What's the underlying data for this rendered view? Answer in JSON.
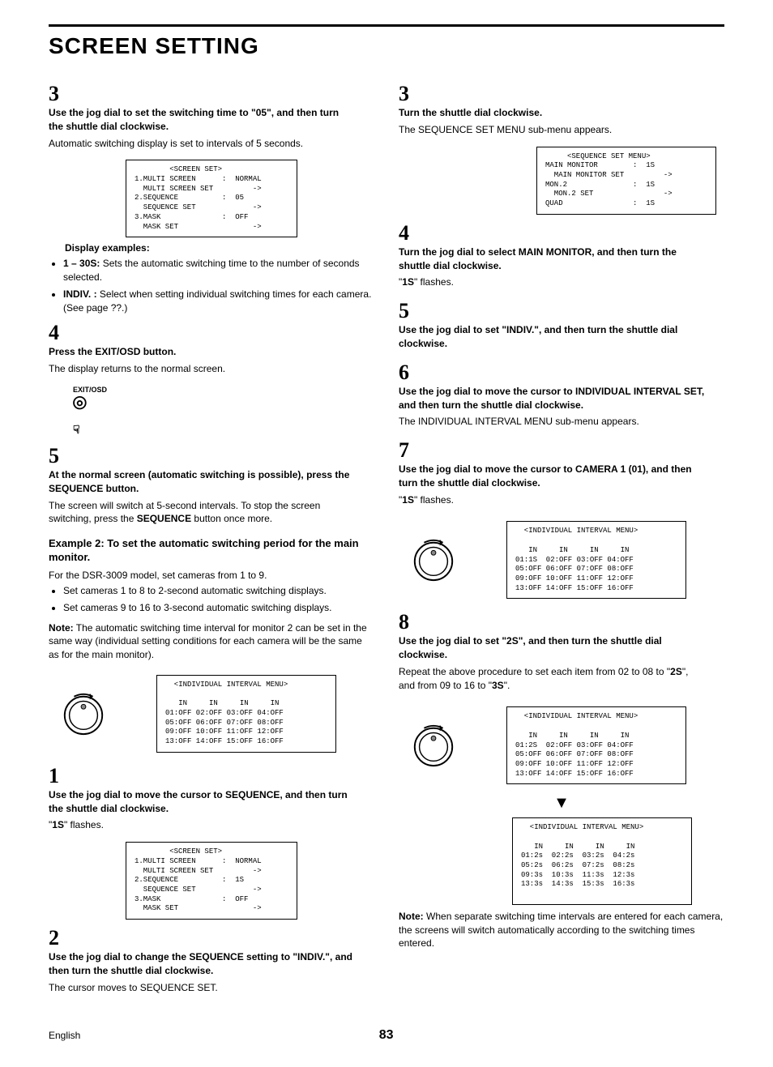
{
  "title": "SCREEN SETTING",
  "left": {
    "s3": {
      "head": "Use the jog dial to set the switching time to \"05\", and then turn the shuttle dial clockwise.",
      "sub": "Automatic switching display is set to intervals of 5 seconds."
    },
    "menu1": "        <SCREEN SET>\n1.MULTI SCREEN      :  NORMAL\n  MULTI SCREEN SET         ->\n2.SEQUENCE          :  05\n  SEQUENCE SET             ->\n3.MASK              :  OFF\n  MASK SET                 ->",
    "disp_ex": "Display examples:",
    "disp_b1a": "1 – 30S:",
    "disp_b1b": " Sets the automatic switching time to the number of seconds selected.",
    "disp_b2a": "INDIV. :",
    "disp_b2b": " Select when setting individual switching times for each camera. (See page ??.)",
    "s4": {
      "head": "Press the EXIT/OSD button.",
      "sub": "The display returns to the normal screen."
    },
    "exit_label": "EXIT/OSD",
    "s5": {
      "head": "At the normal screen (automatic switching is possible), press the SEQUENCE button.",
      "sub1": "The screen will switch at 5-second intervals. To stop the screen switching, press the ",
      "sub2": "SEQUENCE",
      "sub3": " button once more."
    },
    "ex2": "Example 2: To set the automatic switching period for the main monitor.",
    "ex2_p": "For the DSR-3009 model, set cameras from 1 to 9.",
    "ex2_b1": "Set cameras 1 to 8 to 2-second automatic switching displays.",
    "ex2_b2": "Set cameras 9 to 16 to 3-second automatic switching displays.",
    "ex2_note": "The automatic switching time interval for monitor 2 can be set in the same way (individual setting conditions for each camera will be the same as for the main monitor).",
    "menu2": "  <INDIVIDUAL INTERVAL MENU>\n\n   IN     IN     IN     IN\n01:OFF 02:OFF 03:OFF 04:OFF\n05:OFF 06:OFF 07:OFF 08:OFF\n09:OFF 10:OFF 11:OFF 12:OFF\n13:OFF 14:OFF 15:OFF 16:OFF",
    "s1": {
      "head": "Use the jog dial to move the cursor to SEQUENCE, and then turn the shuttle dial clockwise.",
      "sub1": "\"",
      "sub2": "1S",
      "sub3": "\" flashes."
    },
    "menu3": "        <SCREEN SET>\n1.MULTI SCREEN      :  NORMAL\n  MULTI SCREEN SET         ->\n2.SEQUENCE          :  1S\n  SEQUENCE SET             ->\n3.MASK              :  OFF\n  MASK SET                 ->",
    "s2": {
      "head": "Use the jog dial to change the SEQUENCE setting to \"INDIV.\", and then turn the shuttle dial clockwise.",
      "sub": "The cursor moves to SEQUENCE SET."
    }
  },
  "right": {
    "s3": {
      "head": "Turn the shuttle dial clockwise.",
      "sub": "The SEQUENCE SET MENU sub-menu appears."
    },
    "menu1": "     <SEQUENCE SET MENU>\nMAIN MONITOR        :  1S\n  MAIN MONITOR SET         ->\nMON.2               :  1S\n  MON.2 SET                ->\nQUAD                :  1S",
    "s4": {
      "head": "Turn the jog dial to select MAIN MONITOR, and then turn the shuttle dial clockwise.",
      "sub1": "\"",
      "sub2": "1S",
      "sub3": "\" flashes."
    },
    "s5": {
      "head": "Use the jog dial to set \"INDIV.\", and then turn the shuttle dial clockwise."
    },
    "s6": {
      "head": "Use the jog dial to move the cursor to INDIVIDUAL INTERVAL SET, and then turn the shuttle dial clockwise.",
      "sub": "The INDIVIDUAL INTERVAL MENU sub-menu appears."
    },
    "s7": {
      "head": "Use the jog dial to move the cursor to CAMERA 1 (01), and then turn the shuttle dial clockwise.",
      "sub1": "\"",
      "sub2": "1S",
      "sub3": "\" flashes."
    },
    "menu2": "  <INDIVIDUAL INTERVAL MENU>\n\n   IN     IN     IN     IN\n01:1S  02:OFF 03:OFF 04:OFF\n05:OFF 06:OFF 07:OFF 08:OFF\n09:OFF 10:OFF 11:OFF 12:OFF\n13:OFF 14:OFF 15:OFF 16:OFF",
    "s8": {
      "head": "Use the jog dial to set \"2S\", and then turn the shuttle dial clockwise.",
      "sub1": "Repeat the above procedure to set each item from 02 to 08 to \"",
      "sub2": "2S",
      "sub3": "\", and from 09 to 16 to \"",
      "sub4": "3S",
      "sub5": "\"."
    },
    "menu3": "  <INDIVIDUAL INTERVAL MENU>\n\n   IN     IN     IN     IN\n01:2S  02:OFF 03:OFF 04:OFF\n05:OFF 06:OFF 07:OFF 08:OFF\n09:OFF 10:OFF 11:OFF 12:OFF\n13:OFF 14:OFF 15:OFF 16:OFF",
    "menu4": "  <INDIVIDUAL INTERVAL MENU>\n\n   IN     IN     IN     IN\n01:2s  02:2s  03:2s  04:2s\n05:2s  06:2s  07:2s  08:2s\n09:3s  10:3s  11:3s  12:3s\n13:3s  14:3s  15:3s  16:3s\n\n",
    "note": "When separate switching time intervals are entered for each camera, the screens will switch automatically according to the switching times entered."
  },
  "footer": {
    "lang": "English",
    "page": "83"
  },
  "labels": {
    "note": "Note:"
  }
}
